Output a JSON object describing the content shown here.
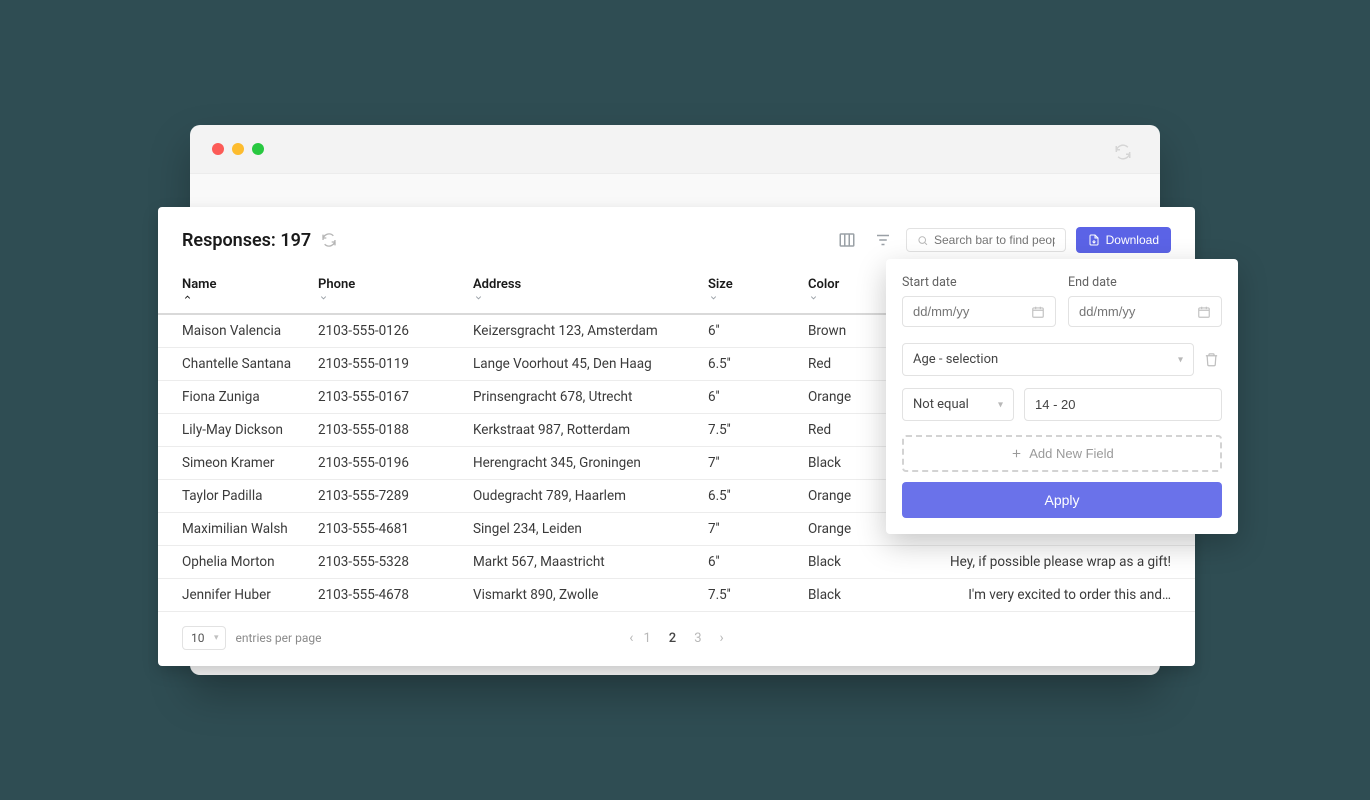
{
  "header": {
    "title_prefix": "Responses:",
    "count": "197",
    "search_placeholder": "Search bar to find people",
    "download_label": "Download"
  },
  "columns": [
    {
      "label": "Name",
      "sort": "asc"
    },
    {
      "label": "Phone",
      "sort": "none"
    },
    {
      "label": "Address",
      "sort": "none"
    },
    {
      "label": "Size",
      "sort": "none"
    },
    {
      "label": "Color",
      "sort": "none"
    },
    {
      "label": "",
      "sort": "blank"
    }
  ],
  "rows": [
    {
      "name": "Maison Valencia",
      "phone": "2103-555-0126",
      "address": "Keizersgracht 123, Amsterdam",
      "size": "6''",
      "color": "Brown",
      "note": ""
    },
    {
      "name": "Chantelle Santana",
      "phone": "2103-555-0119",
      "address": "Lange Voorhout 45, Den Haag",
      "size": "6.5''",
      "color": "Red",
      "note": ""
    },
    {
      "name": "Fiona Zuniga",
      "phone": "2103-555-0167",
      "address": "Prinsengracht 678, Utrecht",
      "size": "6''",
      "color": "Orange",
      "note": ""
    },
    {
      "name": "Lily-May Dickson",
      "phone": "2103-555-0188",
      "address": "Kerkstraat 987, Rotterdam",
      "size": "7.5''",
      "color": "Red",
      "note": ""
    },
    {
      "name": "Simeon Kramer",
      "phone": "2103-555-0196",
      "address": "Herengracht 345, Groningen",
      "size": "7''",
      "color": "Black",
      "note": ""
    },
    {
      "name": "Taylor Padilla",
      "phone": "2103-555-7289",
      "address": "Oudegracht 789, Haarlem",
      "size": "6.5''",
      "color": "Orange",
      "note": ""
    },
    {
      "name": "Maximilian Walsh",
      "phone": "2103-555-4681",
      "address": "Singel 234, Leiden",
      "size": "7''",
      "color": "Orange",
      "note": ""
    },
    {
      "name": "Ophelia Morton",
      "phone": "2103-555-5328",
      "address": "Markt 567, Maastricht",
      "size": "6''",
      "color": "Black",
      "note": "Hey, if possible please wrap as a gift!"
    },
    {
      "name": "Jennifer Huber",
      "phone": "2103-555-4678",
      "address": "Vismarkt 890, Zwolle",
      "size": "7.5''",
      "color": "Black",
      "note": "I'm very excited to order this and…"
    }
  ],
  "footer": {
    "per_page": "10",
    "per_page_label": "entries per page",
    "pages": [
      "1",
      "2",
      "3"
    ],
    "active_page": "2"
  },
  "filter": {
    "start_label": "Start date",
    "end_label": "End date",
    "date_placeholder": "dd/mm/yy",
    "field_select": "Age - selection",
    "operator": "Not equal",
    "value": "14 - 20",
    "add_label": "Add New Field",
    "apply_label": "Apply"
  }
}
